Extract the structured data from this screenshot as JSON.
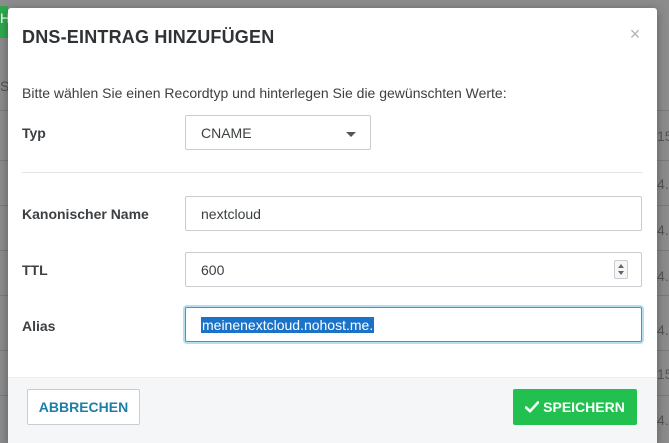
{
  "background": {
    "left_fragments": [
      "H",
      "S"
    ],
    "right_fragments": [
      "15",
      "4.4",
      "4.4",
      "4.4",
      "4.4",
      "15",
      "4.4"
    ]
  },
  "modal": {
    "title": "DNS-EINTRAG HINZUFÜGEN",
    "close_label": "×",
    "intro": "Bitte wählen Sie einen Recordtyp und hinterlegen Sie die gewünschten Werte:",
    "fields": {
      "type": {
        "label": "Typ",
        "value": "CNAME"
      },
      "canonical_name": {
        "label": "Kanonischer Name",
        "value": "nextcloud"
      },
      "ttl": {
        "label": "TTL",
        "value": "600"
      },
      "alias": {
        "label": "Alias",
        "value": "meinenextcloud.nohost.me."
      }
    },
    "footer": {
      "cancel_label": "ABBRECHEN",
      "save_label": "SPEICHERN"
    }
  },
  "colors": {
    "accent": "#22c14f",
    "link": "#1c7fa8",
    "focus": "#2aa1d3",
    "selection": "#1a73c9"
  },
  "icons": {
    "save": "check-icon",
    "close": "close-icon",
    "select": "chevron-down-icon"
  }
}
